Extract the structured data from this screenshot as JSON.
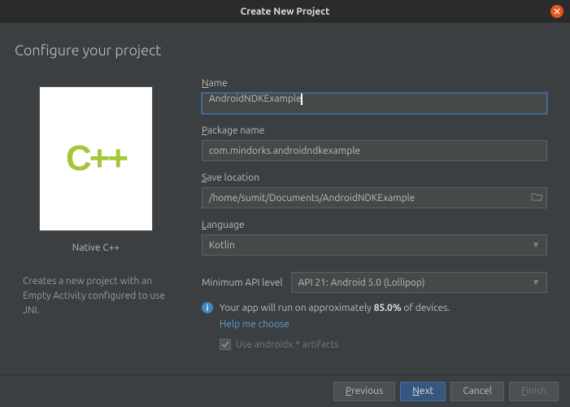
{
  "window": {
    "title": "Create New Project"
  },
  "heading": "Configure your project",
  "template": {
    "logo_text": "C++",
    "name": "Native C++",
    "description": "Creates a new project with an Empty Activity configured to use JNI."
  },
  "fields": {
    "name": {
      "label_pre": "N",
      "label_rest": "ame",
      "value": "AndroidNDKExample"
    },
    "package": {
      "label_pre": "P",
      "label_rest": "ackage name",
      "value": "com.mindorks.androidndkexample"
    },
    "save": {
      "label_pre": "S",
      "label_rest": "ave location",
      "value": "/home/sumit/Documents/AndroidNDKExample"
    },
    "language": {
      "label_pre": "L",
      "label_rest": "anguage",
      "value": "Kotlin"
    },
    "api": {
      "label": "Minimum API level",
      "value": "API 21: Android 5.0 (Lollipop)"
    }
  },
  "info": {
    "text_pre": "Your app will run on approximately ",
    "percent": "85.0%",
    "text_post": " of devices.",
    "help": "Help me choose"
  },
  "checkbox": {
    "label": "Use androidx.* artifacts",
    "checked": true
  },
  "footer": {
    "previous": {
      "mn": "P",
      "rest": "revious"
    },
    "next": {
      "mn": "N",
      "rest": "ext"
    },
    "cancel": "Cancel",
    "finish": {
      "mn": "F",
      "rest": "inish"
    }
  }
}
